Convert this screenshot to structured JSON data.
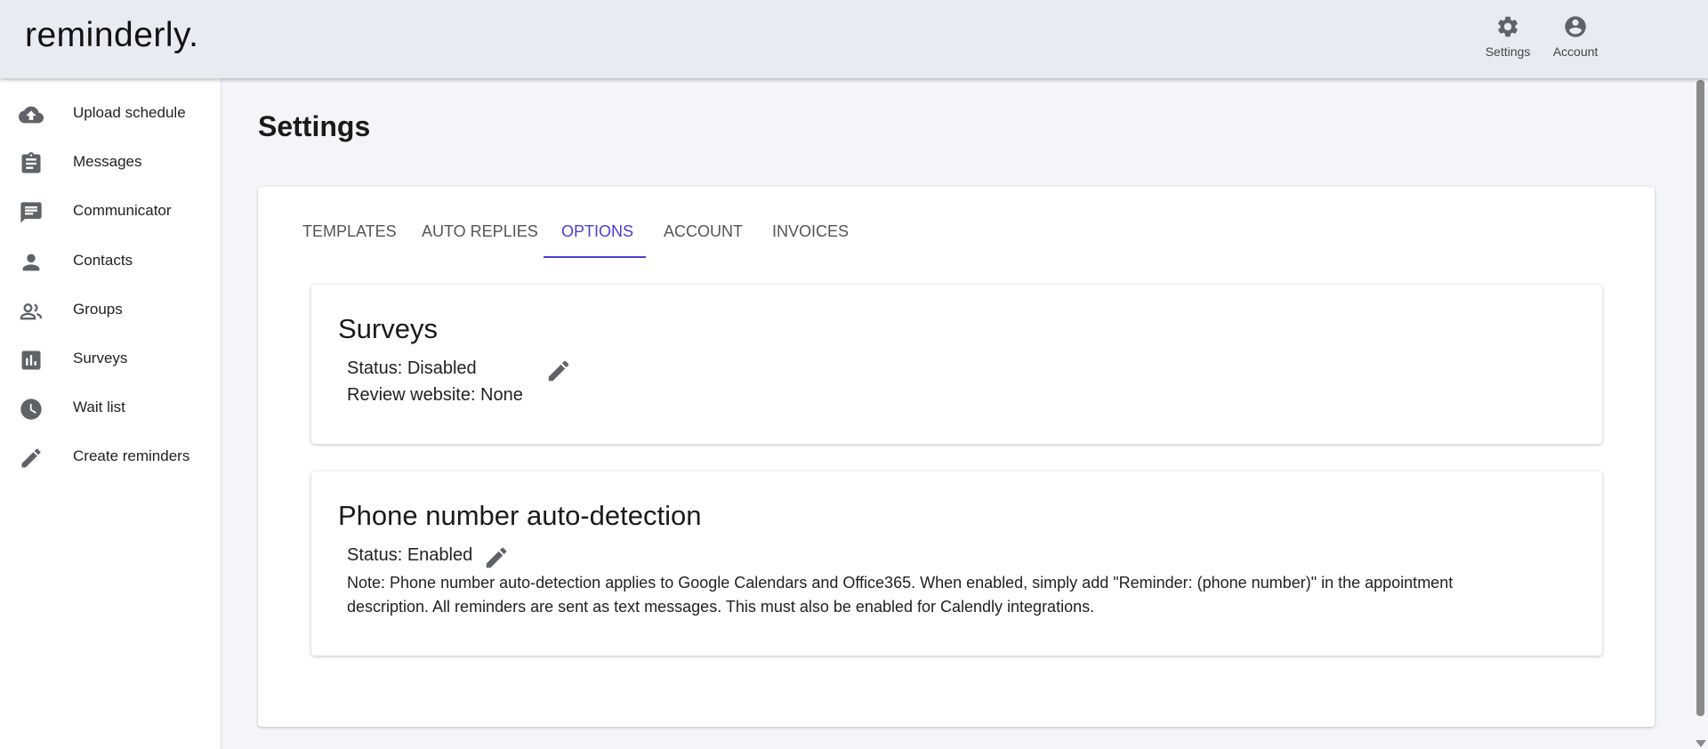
{
  "app": {
    "logo": "reminderly."
  },
  "header": {
    "settings_label": "Settings",
    "account_label": "Account"
  },
  "sidebar": {
    "items": [
      {
        "label": "Upload schedule",
        "icon": "cloud-upload-icon"
      },
      {
        "label": "Messages",
        "icon": "clipboard-icon"
      },
      {
        "label": "Communicator",
        "icon": "chat-icon"
      },
      {
        "label": "Contacts",
        "icon": "person-icon"
      },
      {
        "label": "Groups",
        "icon": "people-icon"
      },
      {
        "label": "Surveys",
        "icon": "bar-chart-icon"
      },
      {
        "label": "Wait list",
        "icon": "clock-icon"
      },
      {
        "label": "Create reminders",
        "icon": "pencil-icon"
      }
    ]
  },
  "main": {
    "page_title": "Settings",
    "tabs": [
      {
        "label": "TEMPLATES"
      },
      {
        "label": "AUTO REPLIES"
      },
      {
        "label": "OPTIONS",
        "active": true
      },
      {
        "label": "ACCOUNT"
      },
      {
        "label": "INVOICES"
      }
    ],
    "surveys": {
      "title": "Surveys",
      "status": "Status: Disabled",
      "review": "Review website: None"
    },
    "phone": {
      "title": "Phone number auto-detection",
      "status": "Status: Enabled",
      "note": "Note: Phone number auto-detection applies to Google Calendars and Office365. When enabled, simply add \"Reminder: (phone number)\" in the appointment description. All reminders are sent as text messages. This must also be enabled for Calendly integrations."
    }
  },
  "colors": {
    "accent": "#4a3fd0",
    "header_bg": "#e9ebf2",
    "page_bg": "#f4f5f9",
    "icon": "#5f6368"
  }
}
